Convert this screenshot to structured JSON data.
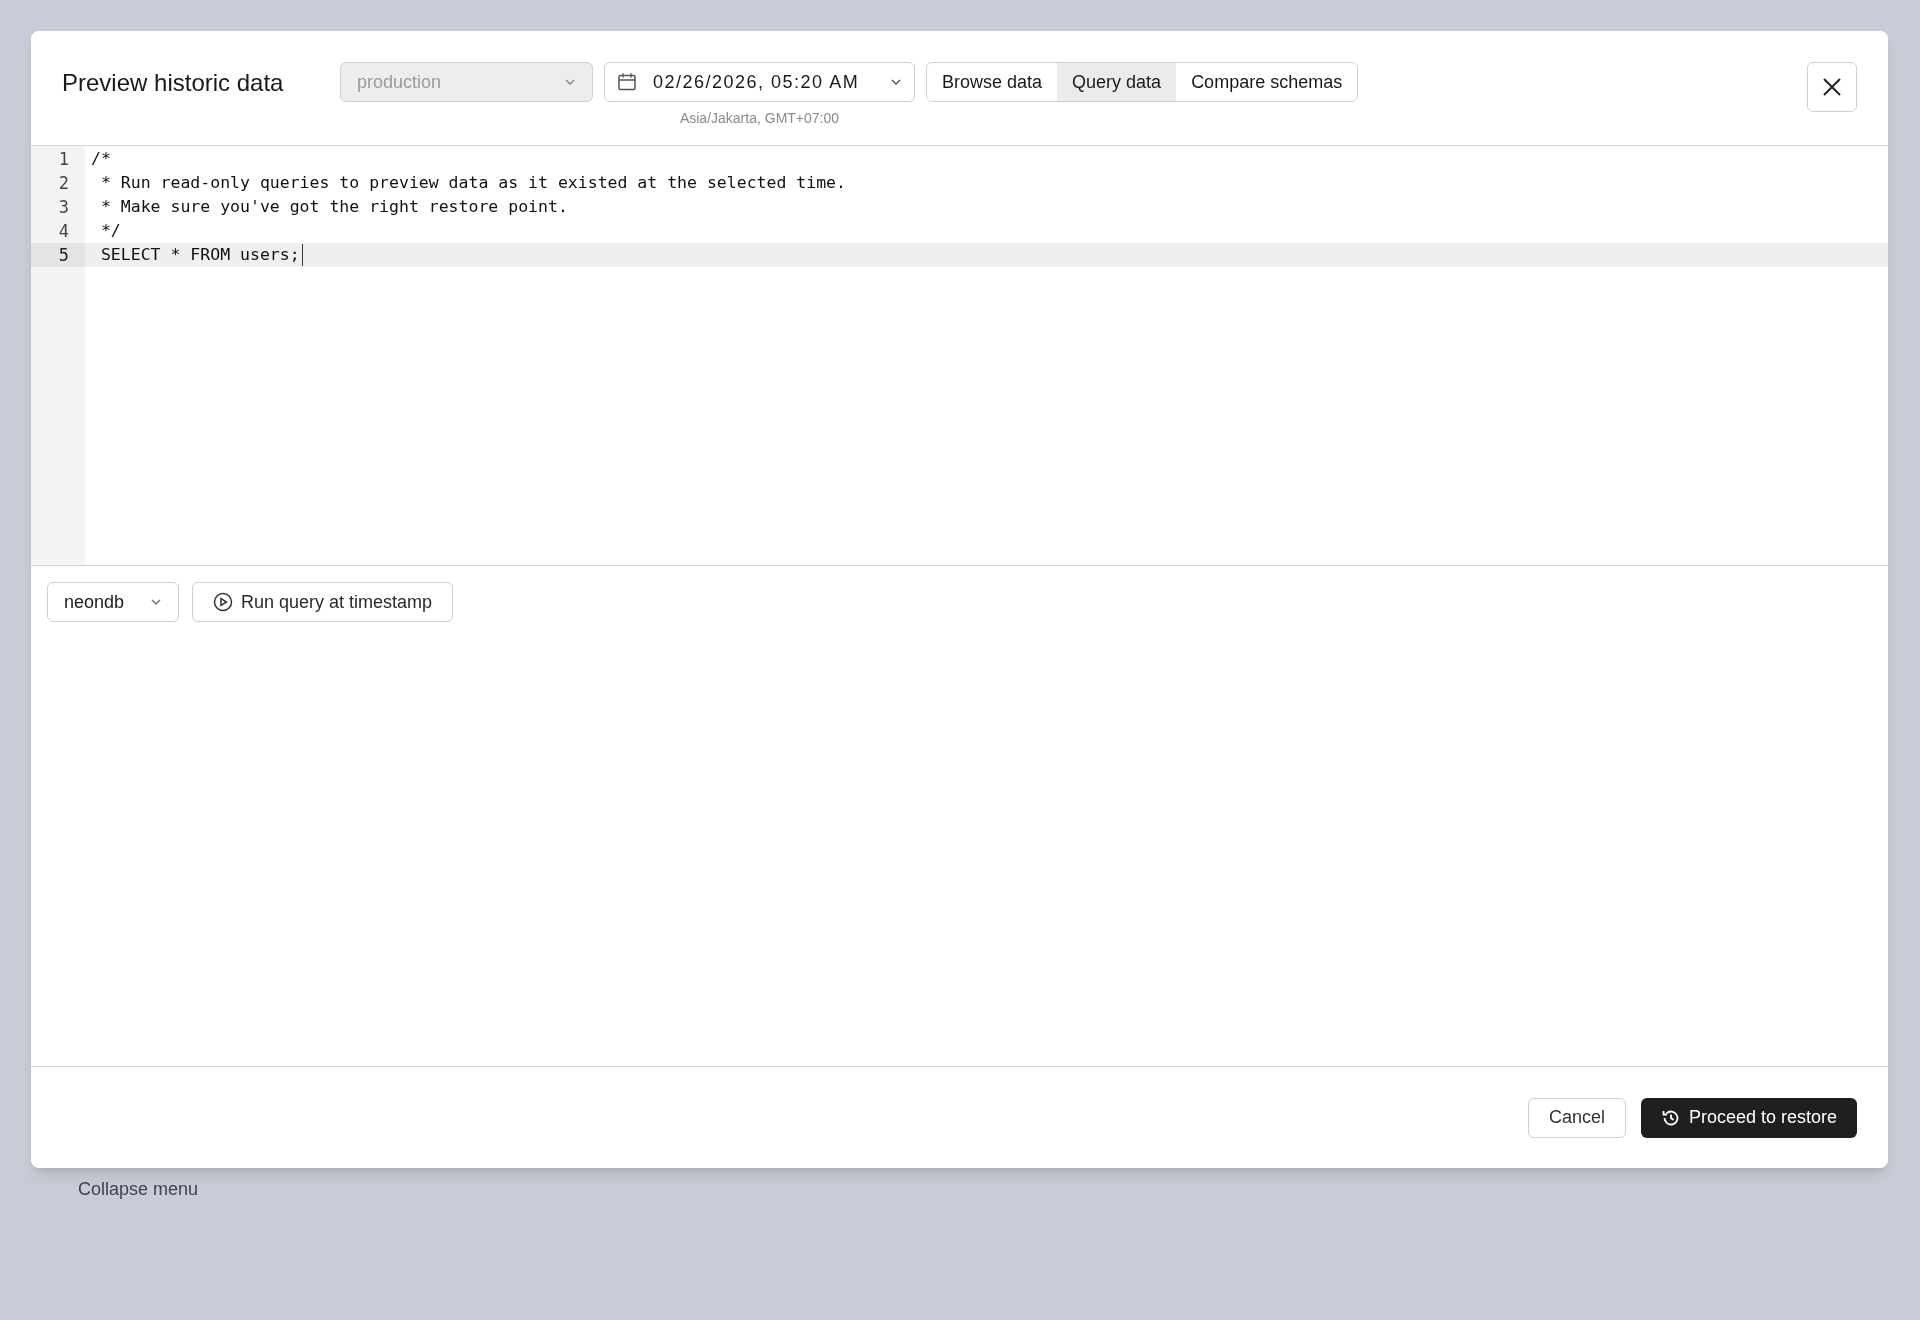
{
  "background": {
    "sidebar_item": "Collapse menu"
  },
  "dialog": {
    "title": "Preview historic data",
    "branch_select": {
      "value": "production",
      "disabled": true
    },
    "timestamp": {
      "value": "02/26/2026, 05:20 AM",
      "timezone": "Asia/Jakarta, GMT+07:00"
    },
    "tabs": [
      {
        "label": "Browse data",
        "selected": false
      },
      {
        "label": "Query data",
        "selected": true
      },
      {
        "label": "Compare schemas",
        "selected": false
      }
    ],
    "editor": {
      "lines": [
        {
          "number": "1",
          "text": "/*",
          "active": false
        },
        {
          "number": "2",
          "text": " * Run read-only queries to preview data as it existed at the selected time.",
          "active": false
        },
        {
          "number": "3",
          "text": " * Make sure you've got the right restore point.",
          "active": false
        },
        {
          "number": "4",
          "text": " */",
          "active": false
        },
        {
          "number": "5",
          "text": " SELECT * FROM users;",
          "active": true
        }
      ]
    },
    "database_select": {
      "value": "neondb"
    },
    "run_button": "Run query at timestamp",
    "buttons": [
      {
        "label": "Cancel",
        "kind": "secondary"
      },
      {
        "label": "Proceed to restore",
        "kind": "primary"
      }
    ]
  }
}
